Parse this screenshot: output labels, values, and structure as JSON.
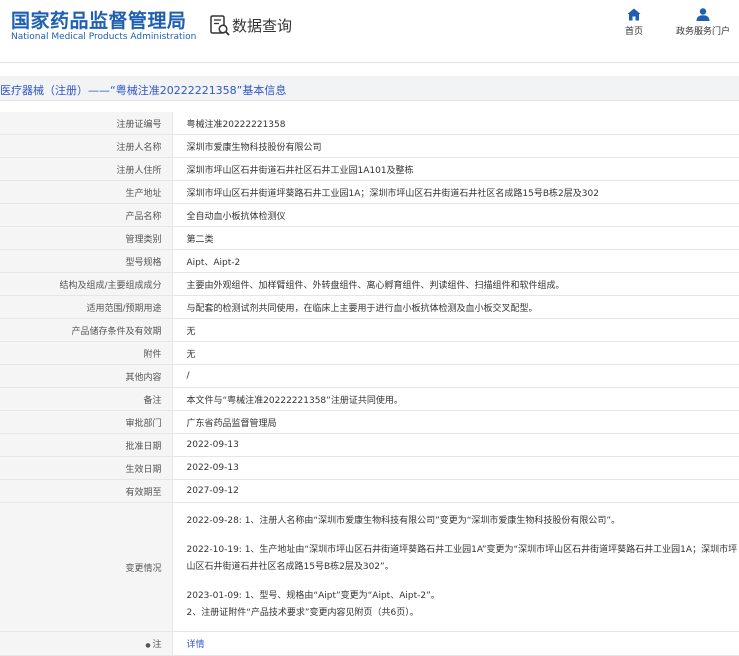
{
  "header": {
    "site_name": "国家药品监督管理局",
    "site_name_en": "National Medical Products Administration",
    "db_title": "数据查询",
    "nav": [
      {
        "icon": "home-icon",
        "label": "首页"
      },
      {
        "icon": "user-icon",
        "label": "政务服务门户"
      }
    ]
  },
  "breadcrumb": "医疗器械（注册）——“粤械注准20222221358”基本信息",
  "fields": [
    {
      "label": "注册证编号",
      "value": "粤械注准20222221358"
    },
    {
      "label": "注册人名称",
      "value": "深圳市爱康生物科技股份有限公司"
    },
    {
      "label": "注册人住所",
      "value": "深圳市坪山区石井街道石井社区石井工业园1A101及整栋"
    },
    {
      "label": "生产地址",
      "value": "深圳市坪山区石井街道坪葵路石井工业园1A；深圳市坪山区石井街道石井社区名成路15号B栋2层及302"
    },
    {
      "label": "产品名称",
      "value": "全自动血小板抗体检测仪"
    },
    {
      "label": "管理类别",
      "value": "第二类"
    },
    {
      "label": "型号规格",
      "value": "Aipt、Aipt-2"
    },
    {
      "label": "结构及组成/主要组成成分",
      "value": "主要由外观组件、加样臂组件、外转盘组件、离心孵育组件、判读组件、扫描组件和软件组成。"
    },
    {
      "label": "适用范围/预期用途",
      "value": "与配套的检测试剂共同使用，在临床上主要用于进行血小板抗体检测及血小板交叉配型。"
    },
    {
      "label": "产品储存条件及有效期",
      "value": "无"
    },
    {
      "label": "附件",
      "value": "无"
    },
    {
      "label": "其他内容",
      "value": "/"
    },
    {
      "label": "备注",
      "value": "本文件与“粤械注准20222221358”注册证共同使用。"
    },
    {
      "label": "审批部门",
      "value": "广东省药品监督管理局"
    },
    {
      "label": "批准日期",
      "value": "2022-09-13"
    },
    {
      "label": "生效日期",
      "value": "2022-09-13"
    },
    {
      "label": "有效期至",
      "value": "2027-09-12"
    }
  ],
  "changes": {
    "label": "变更情况",
    "entries": [
      "2022-09-28: 1、注册人名称由“深圳市爱康生物科技有限公司”变更为“深圳市爱康生物科技股份有限公司”。",
      "2022-10-19: 1、生产地址由“深圳市坪山区石井街道坪葵路石井工业园1A”变更为“深圳市坪山区石井街道坪葵路石井工业园1A；深圳市坪山区石井街道石井社区名成路15号B栋2层及302”。",
      "2023-01-09: 1、型号、规格由“Aipt”变更为“Aipt、Aipt-2”。\n2、注册证附件“产品技术要求”变更内容见附页（共6页）。"
    ]
  },
  "note": {
    "label": "注",
    "link": "详情"
  }
}
